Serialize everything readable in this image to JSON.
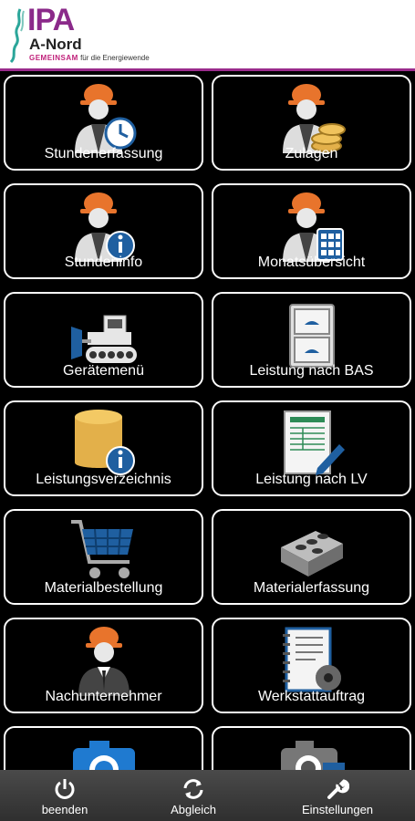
{
  "header": {
    "logo_ipa": "IPA",
    "logo_anord": "A-Nord",
    "logo_tag_highlight": "GEMEINSAM",
    "logo_tag_rest": " für die Energiewende"
  },
  "tiles": [
    {
      "label": "Stundenerfassung",
      "icon": "worker-clock-icon"
    },
    {
      "label": "Zulagen",
      "icon": "worker-coins-icon"
    },
    {
      "label": "Stundeninfo",
      "icon": "worker-info-icon"
    },
    {
      "label": "Monatsübersicht",
      "icon": "worker-calculator-icon"
    },
    {
      "label": "Gerätemenü",
      "icon": "bulldozer-icon"
    },
    {
      "label": "Leistung nach BAS",
      "icon": "drawer-cabinet-icon"
    },
    {
      "label": "Leistungsverzeichnis",
      "icon": "database-info-icon"
    },
    {
      "label": "Leistung nach LV",
      "icon": "document-pen-icon"
    },
    {
      "label": "Materialbestellung",
      "icon": "shopping-cart-icon"
    },
    {
      "label": "Materialerfassung",
      "icon": "brick-icon"
    },
    {
      "label": "Nachunternehmer",
      "icon": "worker-suit-icon"
    },
    {
      "label": "Werkstattauftrag",
      "icon": "notebook-gear-icon"
    },
    {
      "label": "",
      "icon": "camera-icon"
    },
    {
      "label": "",
      "icon": "camera-document-icon"
    }
  ],
  "bottom_bar": {
    "quit_label": "beenden",
    "sync_label": "Abgleich",
    "settings_label": "Einstellungen"
  },
  "colors": {
    "brand": "#8b2a8a",
    "helmet": "#e8742c",
    "blue": "#1f5fa0"
  }
}
